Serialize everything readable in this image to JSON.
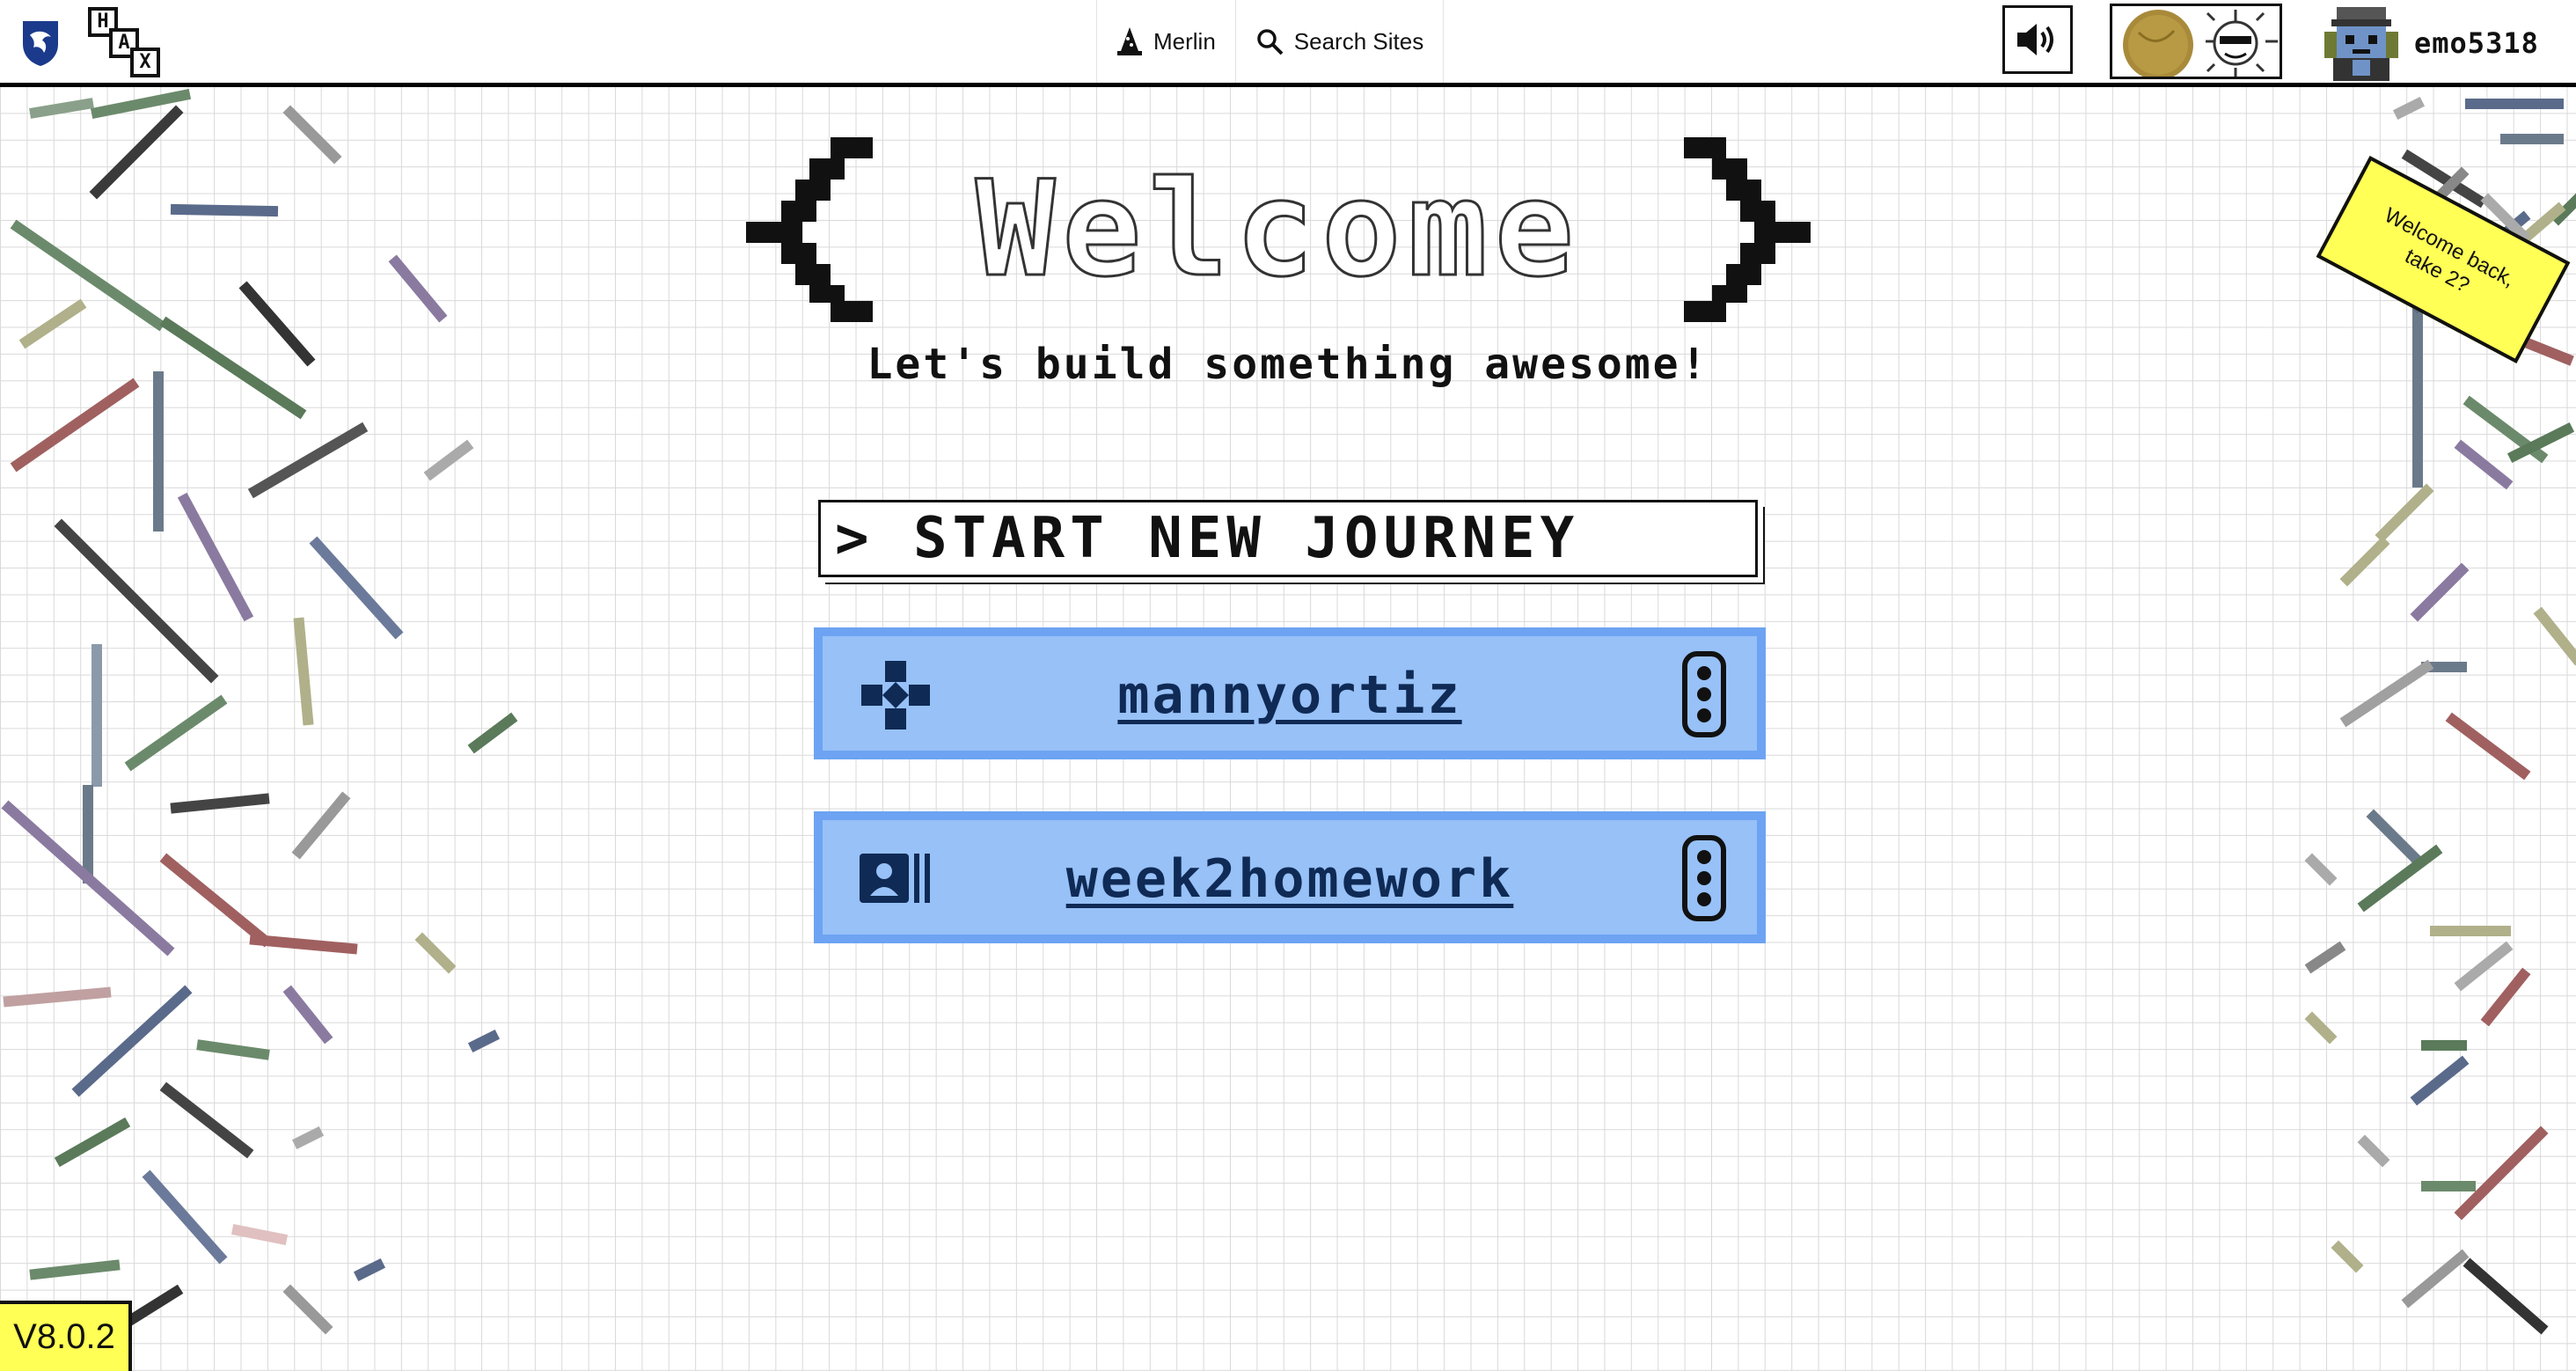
{
  "topbar": {
    "logo_icon": "shield-logo-icon",
    "hax_logo": {
      "letters": [
        "H",
        "A",
        "X"
      ],
      "icon": "hax-logo-icon"
    },
    "merlin": {
      "label": "Merlin",
      "icon": "wizard-hat-icon"
    },
    "search": {
      "label": "Search Sites",
      "icon": "search-icon"
    },
    "sound_icon": "speaker-icon",
    "theme_icon": "sun-moon-toggle-icon",
    "username": "emo5318"
  },
  "hero": {
    "title": "Welcome",
    "subtitle": "Let's build something awesome!"
  },
  "actions": {
    "start_label": "> START NEW JOURNEY"
  },
  "sites": [
    {
      "title": "mannyortiz",
      "icon": "gamepad-icon"
    },
    {
      "title": "week2homework",
      "icon": "contact-card-icon"
    }
  ],
  "sticky_note": "Welcome back, take 2?",
  "version": "V8.0.2",
  "colors": {
    "card_fill": "#97c1f7",
    "card_border": "#6da3f2",
    "card_text": "#0f2a55",
    "highlight_yellow": "#ffff55"
  }
}
